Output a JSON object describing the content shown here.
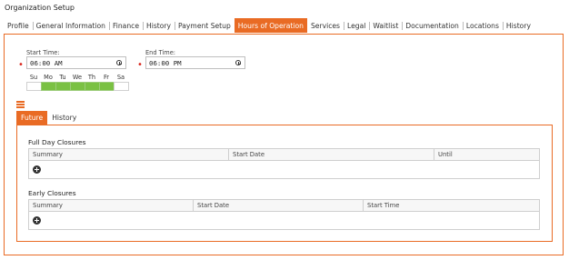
{
  "page_title": "Organization Setup",
  "tabs": [
    {
      "label": "Profile"
    },
    {
      "label": "General Information"
    },
    {
      "label": "Finance"
    },
    {
      "label": "History"
    },
    {
      "label": "Payment Setup"
    },
    {
      "label": "Hours of Operation",
      "active": true
    },
    {
      "label": "Services"
    },
    {
      "label": "Legal"
    },
    {
      "label": "Waitlist"
    },
    {
      "label": "Documentation"
    },
    {
      "label": "Locations"
    },
    {
      "label": "History"
    }
  ],
  "hours": {
    "start_label": "Start Time:",
    "start_value": "06:00 AM",
    "end_label": "End Time:",
    "end_value": "06:00 PM",
    "required_mark": "•",
    "days": [
      {
        "label": "Su",
        "selected": false
      },
      {
        "label": "Mo",
        "selected": true
      },
      {
        "label": "Tu",
        "selected": true
      },
      {
        "label": "We",
        "selected": true
      },
      {
        "label": "Th",
        "selected": true
      },
      {
        "label": "Fr",
        "selected": true
      },
      {
        "label": "Sa",
        "selected": false
      }
    ]
  },
  "subtabs": [
    {
      "label": "Future",
      "active": true
    },
    {
      "label": "History"
    }
  ],
  "full_day_closures": {
    "title": "Full Day Closures",
    "columns": [
      "Summary",
      "Start Date",
      "Until"
    ]
  },
  "early_closures": {
    "title": "Early Closures",
    "columns": [
      "Summary",
      "Start Date",
      "Start Time"
    ]
  },
  "colors": {
    "accent": "#e96b24",
    "day_selected": "#7ac143",
    "required": "#d9261c"
  },
  "icons": {
    "clock": "clock-icon",
    "menu": "hamburger-menu-icon",
    "add": "add-circle-icon"
  }
}
